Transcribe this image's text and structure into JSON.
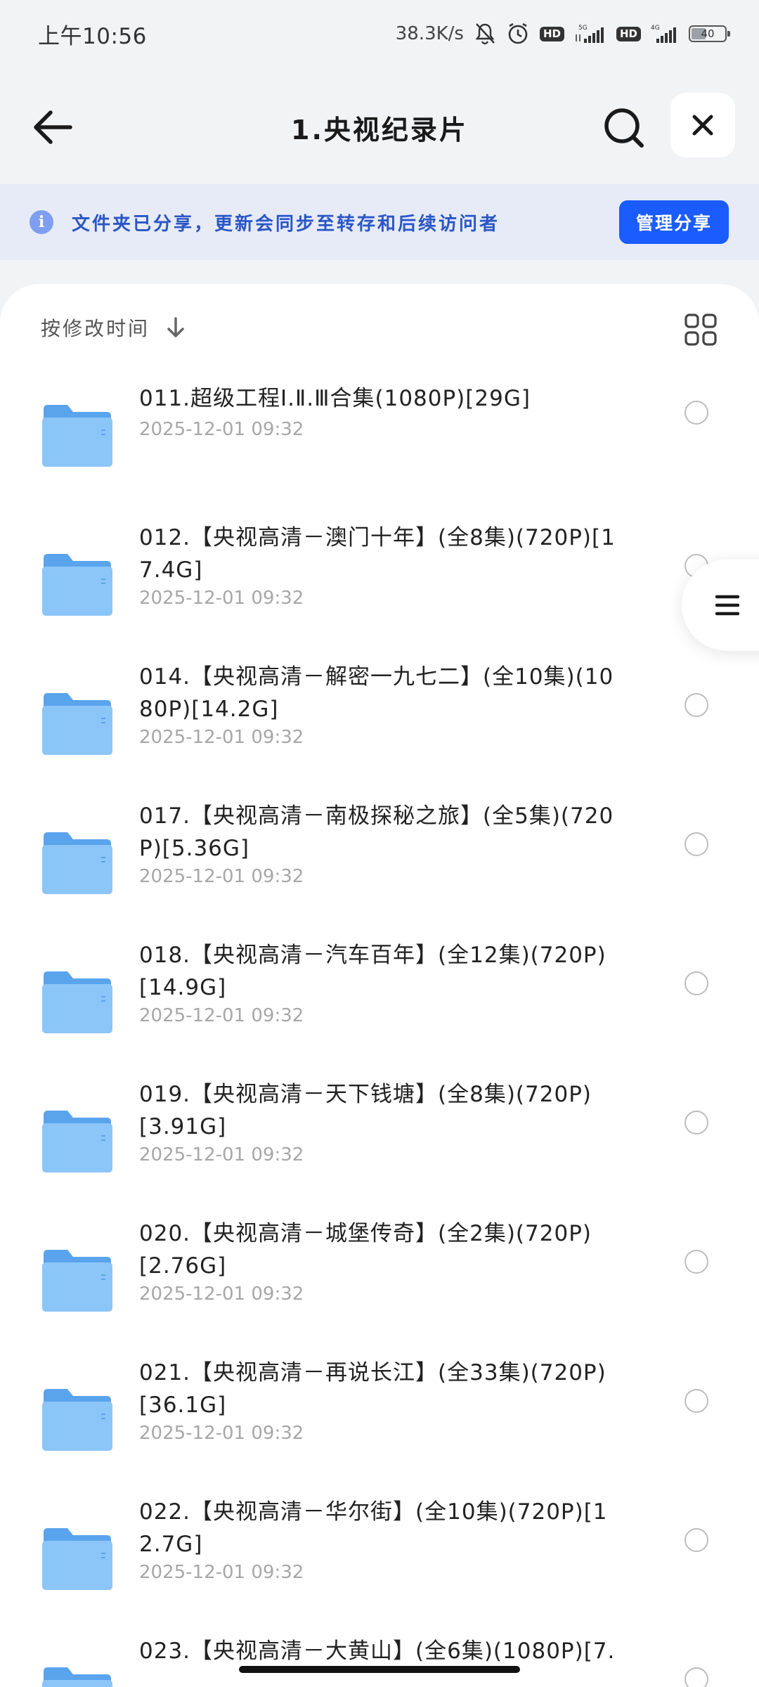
{
  "status_bar": {
    "time": "上午10:56",
    "speed": "38.3K/s",
    "network_left": "5G",
    "network_right": "4G",
    "hd_badge": "HD",
    "battery": "40"
  },
  "header": {
    "title": "1.央视纪录片"
  },
  "share_banner": {
    "text": "文件夹已分享，更新会同步至转存和后续访问者",
    "button_label": "管理分享"
  },
  "sort": {
    "label": "按修改时间"
  },
  "files": [
    {
      "name": "011.超级工程Ⅰ.Ⅱ.Ⅲ合集(1080P)[29G]",
      "date": "2025-12-01 09:32"
    },
    {
      "name": "012.【央视高清－澳门十年】(全8集)(720P)[17.4G]",
      "date": "2025-12-01 09:32"
    },
    {
      "name": "014.【央视高清－解密一九七二】(全10集)(1080P)[14.2G]",
      "date": "2025-12-01 09:32"
    },
    {
      "name": "017.【央视高清－南极探秘之旅】(全5集)(720P)[5.36G]",
      "date": "2025-12-01 09:32"
    },
    {
      "name": "018.【央视高清－汽车百年】(全12集)(720P)[14.9G]",
      "date": "2025-12-01 09:32"
    },
    {
      "name": "019.【央视高清－天下钱塘】(全8集)(720P)[3.91G]",
      "date": "2025-12-01 09:32"
    },
    {
      "name": "020.【央视高清－城堡传奇】(全2集)(720P)[2.76G]",
      "date": "2025-12-01 09:32"
    },
    {
      "name": "021.【央视高清－再说长江】(全33集)(720P)[36.1G]",
      "date": "2025-12-01 09:32"
    },
    {
      "name": "022.【央视高清－华尔街】(全10集)(720P)[12.7G]",
      "date": "2025-12-01 09:32"
    },
    {
      "name": "023.【央视高清－大黄山】(全6集)(1080P)[7.",
      "date": ""
    }
  ],
  "colors": {
    "accent": "#1a5cff",
    "banner_bg": "#e7ebf8",
    "banner_text": "#2a56c6",
    "folder": "#6db0f2"
  }
}
